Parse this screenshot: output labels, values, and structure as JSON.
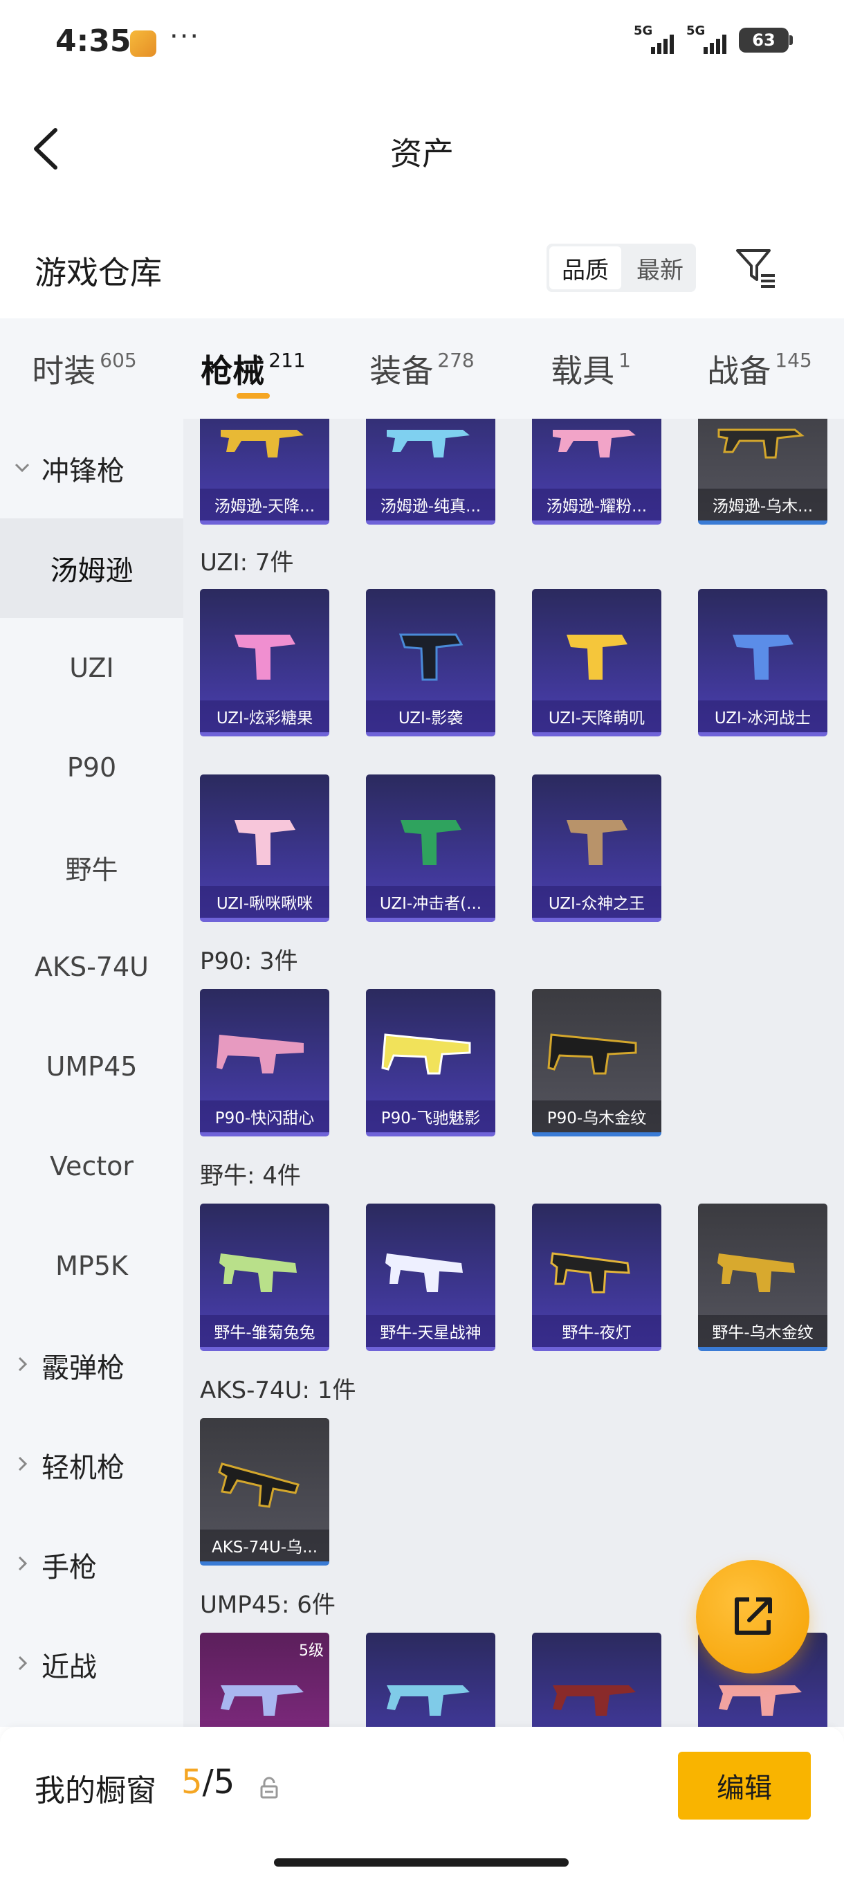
{
  "status_bar": {
    "time": "4:35",
    "dots": "···",
    "net1": "5G",
    "net2": "5G",
    "battery": "63"
  },
  "nav": {
    "title": "资产"
  },
  "warehouse": {
    "title": "游戏仓库",
    "sort_quality": "品质",
    "sort_newest": "最新"
  },
  "tabs": [
    {
      "label": "时装",
      "count": "605"
    },
    {
      "label": "枪械",
      "count": "211"
    },
    {
      "label": "装备",
      "count": "278"
    },
    {
      "label": "载具",
      "count": "1"
    },
    {
      "label": "战备",
      "count": "145"
    }
  ],
  "sidebar": {
    "g_smg": "冲锋枪",
    "thompson": "汤姆逊",
    "uzi": "UZI",
    "p90": "P90",
    "bison": "野牛",
    "aks": "AKS-74U",
    "ump": "UMP45",
    "vector": "Vector",
    "mp5k": "MP5K",
    "g_shotgun": "霰弹枪",
    "g_lmg": "轻机枪",
    "g_pistol": "手枪",
    "g_melee": "近战"
  },
  "sections": {
    "thompson_items": [
      "汤姆逊-天降...",
      "汤姆逊-纯真...",
      "汤姆逊-耀粉...",
      "汤姆逊-乌木..."
    ],
    "uzi_title": "UZI: 7件",
    "uzi_items": [
      "UZI-炫彩糖果",
      "UZI-影袭",
      "UZI-天降萌叽",
      "UZI-冰河战士",
      "UZI-啾咪啾咪",
      "UZI-冲击者(...",
      "UZI-众神之王"
    ],
    "p90_title": "P90: 3件",
    "p90_items": [
      "P90-快闪甜心",
      "P90-飞驰魅影",
      "P90-乌木金纹"
    ],
    "bison_title": "野牛: 4件",
    "bison_items": [
      "野牛-雏菊兔兔",
      "野牛-天星战神",
      "野牛-夜灯",
      "野牛-乌木金纹"
    ],
    "aks_title": "AKS-74U: 1件",
    "aks_items": [
      "AKS-74U-乌..."
    ],
    "ump_title": "UMP45: 6件",
    "ump_level": "5级"
  },
  "bottom_bar": {
    "label": "我的橱窗",
    "current": "5",
    "sep": "/",
    "total": "5",
    "edit": "编辑"
  },
  "colors": {
    "accent": "#f5a623",
    "button": "#f9b400",
    "card_epic": "#3d3690",
    "card_gold": "#4a4a52"
  }
}
